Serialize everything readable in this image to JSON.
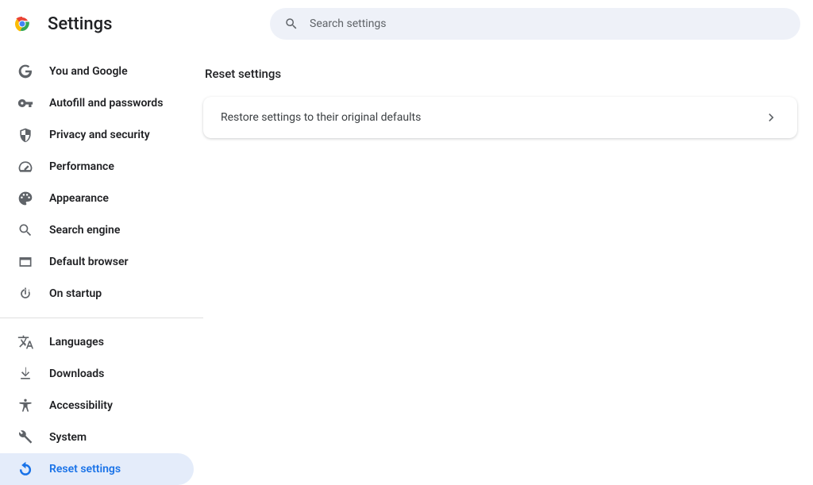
{
  "header": {
    "title": "Settings",
    "search_placeholder": "Search settings"
  },
  "sidebar": {
    "group1": [
      {
        "label": "You and Google"
      },
      {
        "label": "Autofill and passwords"
      },
      {
        "label": "Privacy and security"
      },
      {
        "label": "Performance"
      },
      {
        "label": "Appearance"
      },
      {
        "label": "Search engine"
      },
      {
        "label": "Default browser"
      },
      {
        "label": "On startup"
      }
    ],
    "group2": [
      {
        "label": "Languages"
      },
      {
        "label": "Downloads"
      },
      {
        "label": "Accessibility"
      },
      {
        "label": "System"
      },
      {
        "label": "Reset settings"
      }
    ]
  },
  "content": {
    "section_title": "Reset settings",
    "row_label": "Restore settings to their original defaults"
  }
}
